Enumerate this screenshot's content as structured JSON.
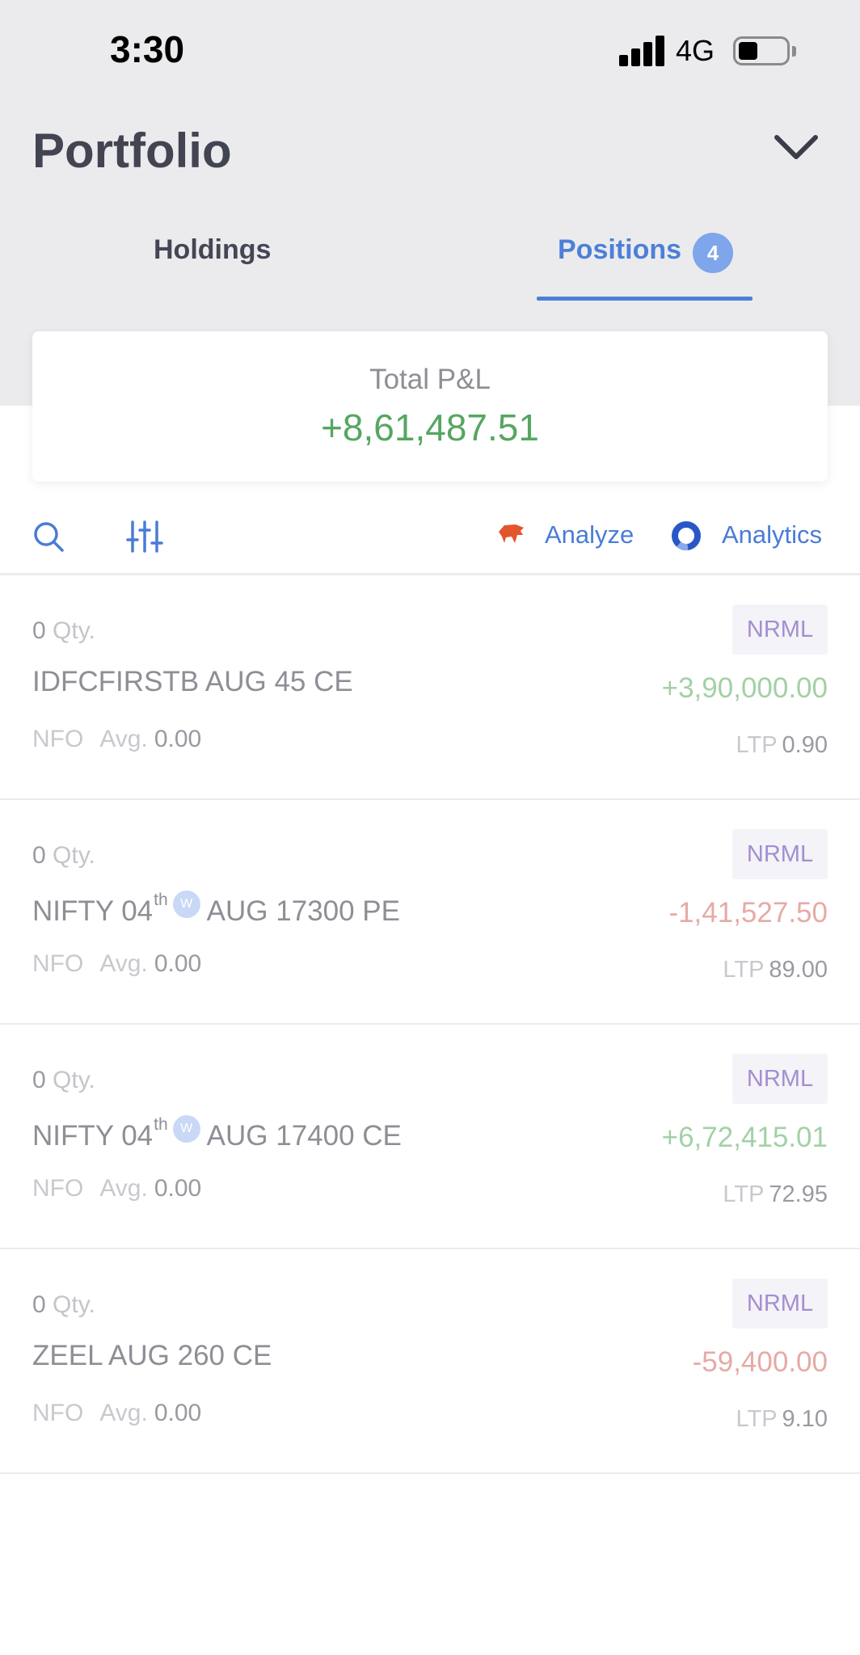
{
  "status_bar": {
    "time": "3:30",
    "network": "4G"
  },
  "header": {
    "title": "Portfolio"
  },
  "tabs": [
    {
      "label": "Holdings",
      "active": false
    },
    {
      "label": "Positions",
      "badge": "4",
      "active": true
    }
  ],
  "summary": {
    "label": "Total P&L",
    "value": "+8,61,487.51",
    "color": "#56a661"
  },
  "toolbar": {
    "search_icon": "search-icon",
    "filter_icon": "sliders-icon",
    "analyze_label": "Analyze",
    "analytics_label": "Analytics"
  },
  "positions": [
    {
      "qty": "0",
      "qty_label": "Qty.",
      "symbol": "IDFCFIRSTB AUG 45 CE",
      "exchange": "NFO",
      "avg_label": "Avg.",
      "avg": "0.00",
      "product": "NRML",
      "pnl": "+3,90,000.00",
      "ltp_label": "LTP",
      "ltp": "0.90"
    },
    {
      "qty": "0",
      "qty_label": "Qty.",
      "symbol_prefix": "NIFTY 04",
      "symbol_suffix": "th",
      "weekly_badge": "W",
      "symbol_rest": "AUG 17300 PE",
      "exchange": "NFO",
      "avg_label": "Avg.",
      "avg": "0.00",
      "product": "NRML",
      "pnl": "-1,41,527.50",
      "ltp_label": "LTP",
      "ltp": "89.00"
    },
    {
      "qty": "0",
      "qty_label": "Qty.",
      "symbol_prefix": "NIFTY 04",
      "symbol_suffix": "th",
      "weekly_badge": "W",
      "symbol_rest": "AUG 17400 CE",
      "exchange": "NFO",
      "avg_label": "Avg.",
      "avg": "0.00",
      "product": "NRML",
      "pnl": "+6,72,415.01",
      "ltp_label": "LTP",
      "ltp": "72.95"
    },
    {
      "qty": "0",
      "qty_label": "Qty.",
      "symbol": "ZEEL AUG 260 CE",
      "exchange": "NFO",
      "avg_label": "Avg.",
      "avg": "0.00",
      "product": "NRML",
      "pnl": "-59,400.00",
      "ltp_label": "LTP",
      "ltp": "9.10"
    }
  ]
}
